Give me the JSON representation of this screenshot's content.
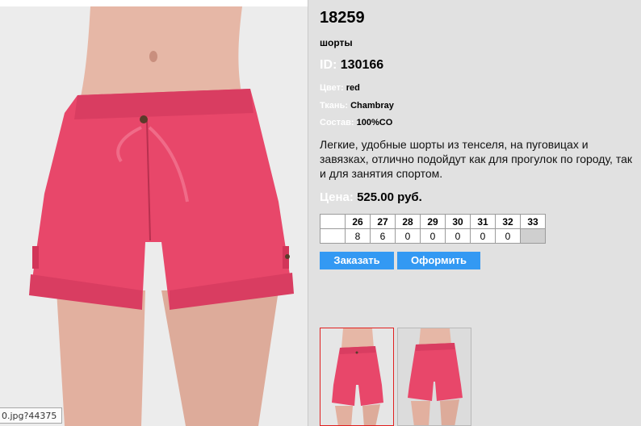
{
  "product": {
    "article": "18259",
    "type": "шорты",
    "id_label": "ID:",
    "id_value": "130166",
    "color_label": "Цвет:",
    "color_value": "red",
    "fabric_label": "Ткань:",
    "fabric_value": "Chambray",
    "composition_label": "Состав:",
    "composition_value": "100%CO",
    "description": "Легкие, удобные шорты из тенселя, на пуговицах и завязках, отлично подойдут как для прогулок по городу, так и для занятия спортом.",
    "price_label": "Цена:",
    "price_value": "525.00 руб."
  },
  "sizes": {
    "labels": [
      "26",
      "27",
      "28",
      "29",
      "30",
      "31",
      "32",
      "33"
    ],
    "stock": [
      "8",
      "6",
      "0",
      "0",
      "0",
      "0",
      "0",
      ""
    ]
  },
  "buttons": {
    "order": "Заказать",
    "checkout": "Оформить"
  },
  "status_tip": "0.jpg?44375",
  "colors": {
    "shorts": "#e8476a",
    "accent_button": "#3399f3",
    "panel_bg": "#e1e1e1"
  }
}
